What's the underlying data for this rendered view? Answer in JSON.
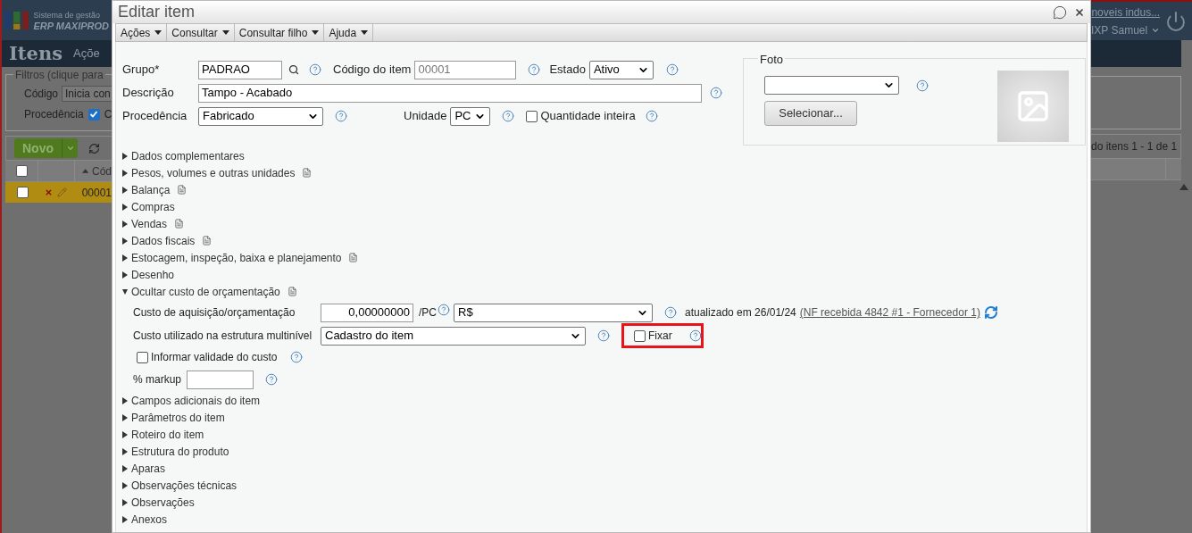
{
  "background": {
    "brand": {
      "line1": "Sistema de gestão",
      "line2": "ERP MAXIPROD"
    },
    "page_title": "Itens",
    "menu_cut": "Açõe",
    "filters_legend": "Filtros (clique para",
    "filter_code_label": "Código",
    "filter_code_value": "Inicia con",
    "filter_origin_label": "Procedência",
    "filter_origin_checked": true,
    "filter_origin_option": "C",
    "new_button": "Novo",
    "table_header": "Cód",
    "header_checked": false,
    "row": {
      "selected": true,
      "checked": false,
      "code": "00001"
    },
    "company_link": "noveis indus...",
    "user": "IXP Samuel",
    "pagination": "do itens 1 - 1 de 1"
  },
  "dialog": {
    "title": "Editar item",
    "menu": [
      {
        "label": "Ações"
      },
      {
        "label": "Consultar"
      },
      {
        "label": "Consultar filho"
      },
      {
        "label": "Ajuda"
      }
    ],
    "group": {
      "label": "Grupo*",
      "value": "PADRAO"
    },
    "code": {
      "label": "Código do item",
      "value": "00001",
      "disabled": true
    },
    "status": {
      "label": "Estado",
      "value": "Ativo"
    },
    "description": {
      "label": "Descrição",
      "value": "Tampo - Acabado"
    },
    "origin": {
      "label": "Procedência",
      "value": "Fabricado"
    },
    "unit": {
      "label": "Unidade",
      "value": "PC"
    },
    "whole_quantity": {
      "label": "Quantidade inteira",
      "checked": false
    },
    "photo": {
      "legend": "Foto",
      "button": "Selecionar..."
    },
    "sections": [
      {
        "label": "Dados complementares",
        "expanded": false,
        "notes": false
      },
      {
        "label": "Pesos, volumes e outras unidades",
        "expanded": false,
        "notes": true
      },
      {
        "label": "Balança",
        "expanded": false,
        "notes": true
      },
      {
        "label": "Compras",
        "expanded": false,
        "notes": false
      },
      {
        "label": "Vendas",
        "expanded": false,
        "notes": true
      },
      {
        "label": "Dados fiscais",
        "expanded": false,
        "notes": true
      },
      {
        "label": "Estocagem, inspeção, baixa e planejamento",
        "expanded": false,
        "notes": true
      },
      {
        "label": "Desenho",
        "expanded": false,
        "notes": false
      },
      {
        "label": "Ocultar custo de orçamentação",
        "expanded": true,
        "notes": true
      },
      {
        "label": "Campos adicionais do item",
        "expanded": false,
        "notes": false
      },
      {
        "label": "Parâmetros do item",
        "expanded": false,
        "notes": false
      },
      {
        "label": "Roteiro do item",
        "expanded": false,
        "notes": false
      },
      {
        "label": "Estrutura do produto",
        "expanded": false,
        "notes": false
      },
      {
        "label": "Aparas",
        "expanded": false,
        "notes": false
      },
      {
        "label": "Observações técnicas",
        "expanded": false,
        "notes": false
      },
      {
        "label": "Observações",
        "expanded": false,
        "notes": false
      },
      {
        "label": "Anexos",
        "expanded": false,
        "notes": false
      }
    ],
    "cost": {
      "label": "Custo de aquisição/orçamentação",
      "value": "0,00000000",
      "per": "/PC",
      "currency": "R$",
      "updated": "atualizado em 26/01/24",
      "source_link": "(NF recebida 4842 #1 - Fornecedor 1)",
      "structure_label": "Custo utilizado na estrutura multinível",
      "structure_value": "Cadastro do item",
      "fix": {
        "label": "Fixar",
        "checked": false,
        "highlighted": true
      },
      "validity": {
        "label": "Informar validade do custo",
        "checked": false
      },
      "markup_label": "% markup"
    }
  }
}
